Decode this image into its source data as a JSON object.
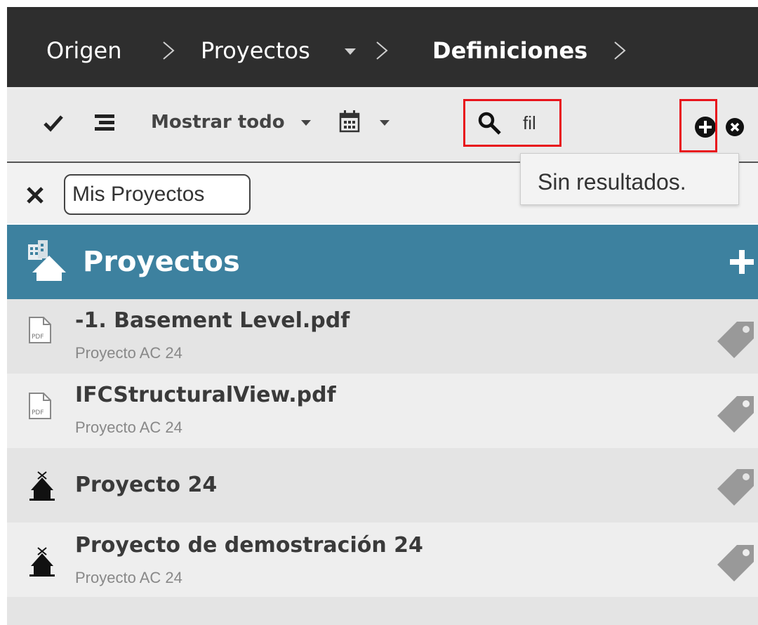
{
  "breadcrumb": {
    "items": [
      {
        "label": "Origen"
      },
      {
        "label": "Proyectos"
      },
      {
        "label": "Definiciones"
      }
    ]
  },
  "toolbar": {
    "view_label": "Mostrar todo",
    "search_value": "fil",
    "tooltip": "Sin resultados."
  },
  "filter": {
    "chip_label": "Mis Proyectos"
  },
  "section": {
    "title": "Proyectos"
  },
  "list": [
    {
      "title": "-1. Basement Level.pdf",
      "subtitle": "Proyecto AC 24",
      "icon": "pdf-file-icon"
    },
    {
      "title": "IFCStructuralView.pdf",
      "subtitle": "Proyecto AC 24",
      "icon": "pdf-file-icon"
    },
    {
      "title": "Proyecto 24",
      "subtitle": "",
      "icon": "project-house-icon"
    },
    {
      "title": "Proyecto de demostración 24",
      "subtitle": "Proyecto AC 24",
      "icon": "project-house-icon"
    }
  ],
  "colors": {
    "topbar": "#2e2e2e",
    "header": "#3d819f",
    "highlight": "#e8141c"
  }
}
